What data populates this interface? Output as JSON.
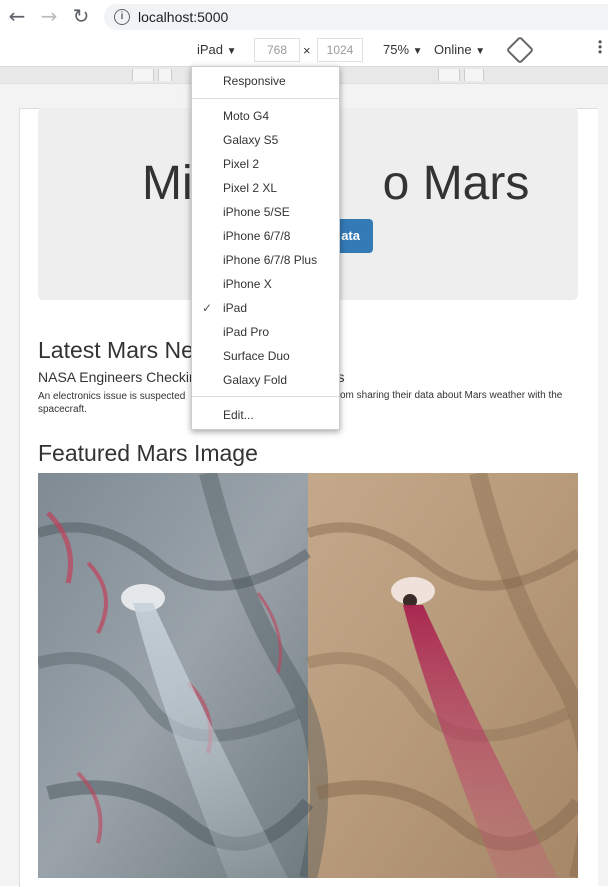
{
  "browser": {
    "back_icon": "arrow-left-icon",
    "forward_icon": "arrow-right-icon",
    "reload_icon": "reload-icon",
    "url": "localhost:5000"
  },
  "device_toolbar": {
    "device": "iPad",
    "width_value": "768",
    "times_symbol": "×",
    "height_value": "1024",
    "zoom": "75%",
    "network": "Online",
    "caret": "▼"
  },
  "device_menu": {
    "responsive": "Responsive",
    "devices": [
      "Moto G4",
      "Galaxy S5",
      "Pixel 2",
      "Pixel 2 XL",
      "iPhone 5/SE",
      "iPhone 6/7/8",
      "iPhone 6/7/8 Plus",
      "iPhone X",
      "iPad",
      "iPad Pro",
      "Surface Duo",
      "Galaxy Fold"
    ],
    "selected": "iPad",
    "check_symbol": "✓",
    "edit": "Edit..."
  },
  "page": {
    "jumbotron_title": "Mi",
    "jumbotron_title_tail": "o Mars",
    "scrape_button_tail": "ata",
    "news_heading": "Latest Mars Ne",
    "news_title": "NASA Engineers Checkin",
    "news_title_tail": "sors",
    "news_paragraph_line1": "An electronics issue is suspected",
    "news_paragraph_line1_tail": "om sharing their data about Mars weather with the",
    "news_paragraph_line2": "spacecraft.",
    "featured_heading": "Featured Mars Image"
  }
}
